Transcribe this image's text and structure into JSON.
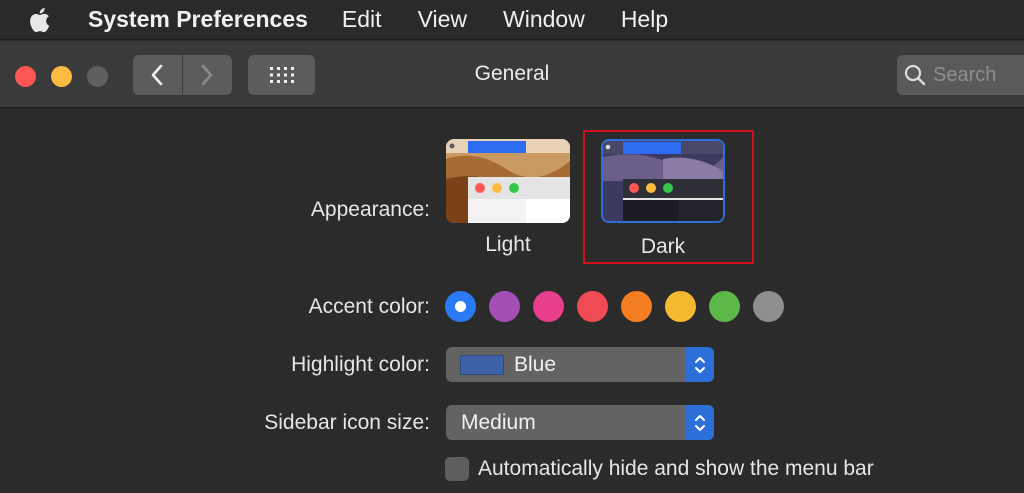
{
  "menubar": {
    "app_name": "System Preferences",
    "items": [
      "Edit",
      "View",
      "Window",
      "Help"
    ]
  },
  "toolbar": {
    "title": "General",
    "search_placeholder": "Search"
  },
  "appearance": {
    "label": "Appearance:",
    "options": [
      {
        "label": "Light",
        "selected": false
      },
      {
        "label": "Dark",
        "selected": true
      }
    ]
  },
  "accent": {
    "label": "Accent color:",
    "colors": [
      "#2a7af5",
      "#a34fb5",
      "#e83e8c",
      "#f04a55",
      "#f57e22",
      "#f5b931",
      "#5cb848",
      "#8e8e8e"
    ],
    "selected_index": 0
  },
  "highlight": {
    "label": "Highlight color:",
    "value": "Blue",
    "swatch_color": "#3d62a8"
  },
  "sidebar_icon": {
    "label": "Sidebar icon size:",
    "value": "Medium"
  },
  "menubar_option": {
    "label": "Automatically hide and show the menu bar",
    "checked": false
  }
}
